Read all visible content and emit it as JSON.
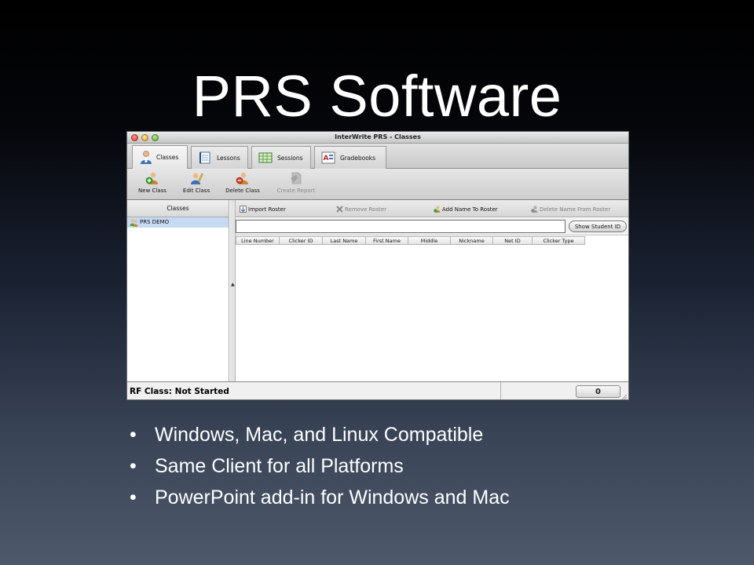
{
  "slide": {
    "title": "PRS Software",
    "bullets": [
      "Windows, Mac, and Linux Compatible",
      "Same Client for all Platforms",
      "PowerPoint add-in for Windows and Mac"
    ],
    "bullet_glyph": "•"
  },
  "window": {
    "title": "InterWrite PRS - Classes",
    "tabs": [
      {
        "label": "Classes",
        "icon": "person-icon",
        "active": true
      },
      {
        "label": "Lessons",
        "icon": "notebook-icon"
      },
      {
        "label": "Sessions",
        "icon": "calendar-grid-icon"
      },
      {
        "label": "Gradebooks",
        "icon": "gradebook-icon"
      }
    ],
    "toolbar": [
      {
        "label": "New Class",
        "icon": "add-person-icon",
        "enabled": true
      },
      {
        "label": "Edit Class",
        "icon": "edit-person-icon",
        "enabled": true
      },
      {
        "label": "Delete Class",
        "icon": "remove-person-icon",
        "enabled": true
      },
      {
        "label": "Create Report",
        "icon": "report-icon",
        "enabled": false
      }
    ],
    "left_panel": {
      "header": "Classes",
      "items": [
        {
          "label": "PRS DEMO",
          "selected": true
        }
      ]
    },
    "roster_toolbar": [
      {
        "label": "Import Roster",
        "icon": "import-icon",
        "enabled": true
      },
      {
        "label": "Remove Roster",
        "icon": "remove-x-icon",
        "enabled": false
      },
      {
        "label": "Add Name To Roster",
        "icon": "add-name-icon",
        "enabled": true
      },
      {
        "label": "Delete Name From Roster",
        "icon": "delete-name-icon",
        "enabled": false
      }
    ],
    "search": {
      "value": "",
      "button_label": "Show Student ID"
    },
    "columns": [
      "Line Number",
      "Clicker ID",
      "Last Name",
      "First Name",
      "Middle",
      "Nickname",
      "Net ID",
      "Clicker Type"
    ],
    "status": {
      "text": "RF Class: Not Started",
      "count": "0"
    }
  },
  "colors": {
    "selection": "#c7daf3",
    "background_top": "#000000",
    "background_bottom": "#4e596b"
  }
}
